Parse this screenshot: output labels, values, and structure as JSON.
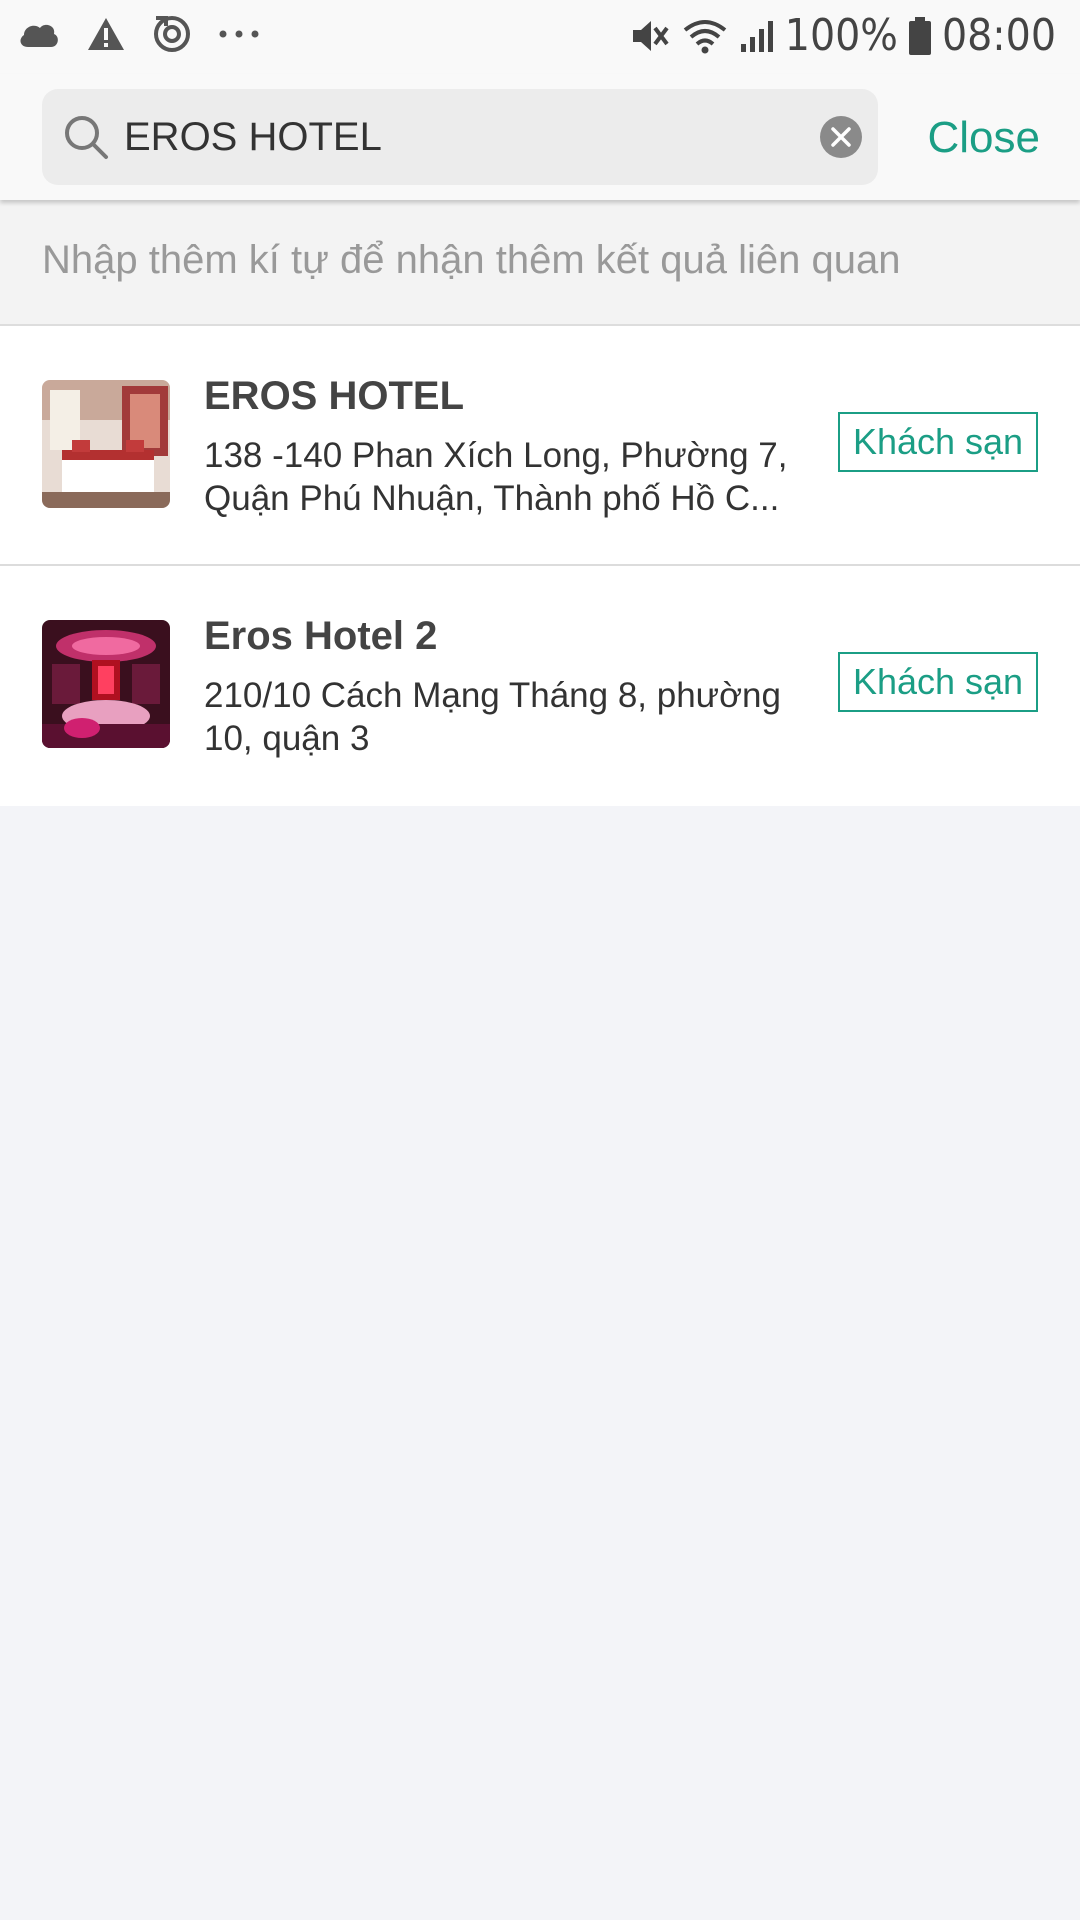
{
  "status_bar": {
    "battery": "100%",
    "time": "08:00",
    "left_icons": [
      "cloud-icon",
      "warning-icon",
      "sync-icon",
      "more-dots-icon"
    ],
    "right_icons": [
      "mute-icon",
      "wifi-icon",
      "signal-icon",
      "battery-icon"
    ]
  },
  "search": {
    "value": "EROS HOTEL",
    "close_label": "Close"
  },
  "hint": "Nhập thêm kí tự để nhận thêm kết quả liên quan",
  "results": [
    {
      "title": "EROS HOTEL",
      "address": "138 -140 Phan Xích Long, Phường 7, Quận Phú Nhuận, Thành phố Hồ C...",
      "category": "Khách sạn"
    },
    {
      "title": "Eros Hotel 2",
      "address": "210/10 Cách Mạng Tháng 8, phường 10, quận 3",
      "category": "Khách sạn"
    }
  ],
  "colors": {
    "accent": "#1b9e85",
    "background": "#f3f4f8"
  }
}
